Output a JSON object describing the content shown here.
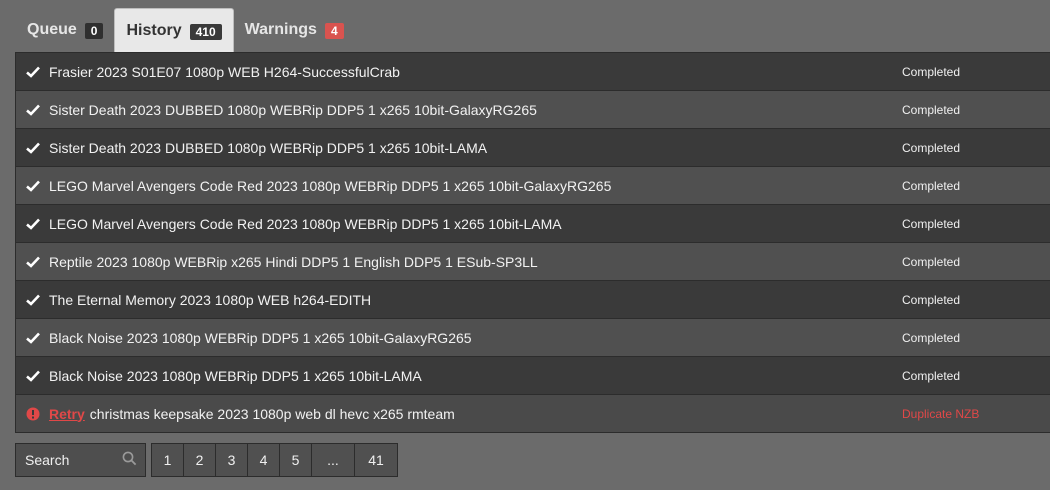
{
  "tabs": [
    {
      "label": "Queue",
      "count": "0"
    },
    {
      "label": "History",
      "count": "410"
    },
    {
      "label": "Warnings",
      "count": "4"
    }
  ],
  "history": [
    {
      "name": "Frasier 2023 S01E07 1080p WEB H264-SuccessfulCrab",
      "status": "Completed"
    },
    {
      "name": "Sister Death 2023 DUBBED 1080p WEBRip DDP5 1 x265 10bit-GalaxyRG265",
      "status": "Completed"
    },
    {
      "name": "Sister Death 2023 DUBBED 1080p WEBRip DDP5 1 x265 10bit-LAMA",
      "status": "Completed"
    },
    {
      "name": "LEGO Marvel Avengers Code Red 2023 1080p WEBRip DDP5 1 x265 10bit-GalaxyRG265",
      "status": "Completed"
    },
    {
      "name": "LEGO Marvel Avengers Code Red 2023 1080p WEBRip DDP5 1 x265 10bit-LAMA",
      "status": "Completed"
    },
    {
      "name": "Reptile 2023 1080p WEBRip x265 Hindi DDP5 1 English DDP5 1 ESub-SP3LL",
      "status": "Completed"
    },
    {
      "name": "The Eternal Memory 2023 1080p WEB h264-EDITH",
      "status": "Completed"
    },
    {
      "name": "Black Noise 2023 1080p WEBRip DDP5 1 x265 10bit-GalaxyRG265",
      "status": "Completed"
    },
    {
      "name": "Black Noise 2023 1080p WEBRip DDP5 1 x265 10bit-LAMA",
      "status": "Completed"
    }
  ],
  "failed": {
    "retry_label": "Retry",
    "name": "christmas keepsake 2023 1080p web dl hevc x265 rmteam",
    "status": "Duplicate NZB"
  },
  "search": {
    "label": "Search"
  },
  "pages": [
    "1",
    "2",
    "3",
    "4",
    "5",
    "...",
    "41"
  ],
  "icons": {
    "done": "checkmark-icon",
    "failed": "exclamation-circle-icon",
    "search": "magnifier-icon"
  },
  "colors": {
    "error": "#e04848",
    "warning_badge": "#d9534f"
  }
}
